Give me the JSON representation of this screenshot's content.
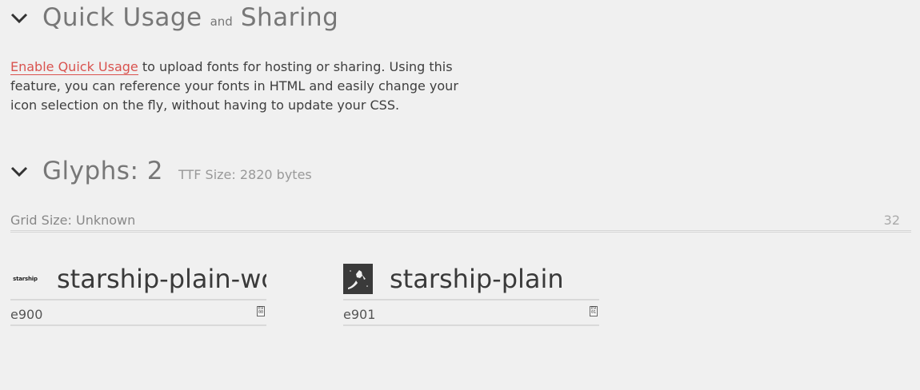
{
  "quick_usage": {
    "title_part1": "Quick Usage",
    "title_and": "and",
    "title_part2": "Sharing",
    "enable_link": "Enable Quick Usage",
    "description": " to upload fonts for hosting or sharing. Using this feature, you can reference your fonts in HTML and easily change your icon selection on the fly, without having to update your CSS."
  },
  "glyphs": {
    "title": "Glyphs: 2",
    "ttf_size": "TTF Size: 2820 bytes",
    "grid_label": "Grid Size: Unknown",
    "grid_value": "32",
    "items": [
      {
        "name": "starship-plain-wordmark",
        "code": "e900",
        "thumb_text": "starship",
        "hex_top": "E9",
        "hex_bottom": "00",
        "icon": "starship-wordmark-icon"
      },
      {
        "name": "starship-plain",
        "code": "e901",
        "thumb_text": "",
        "hex_top": "E9",
        "hex_bottom": "01",
        "icon": "starship-icon"
      }
    ]
  },
  "colors": {
    "background": "#f0f0f0",
    "link": "#d9534f",
    "heading": "#777777"
  }
}
